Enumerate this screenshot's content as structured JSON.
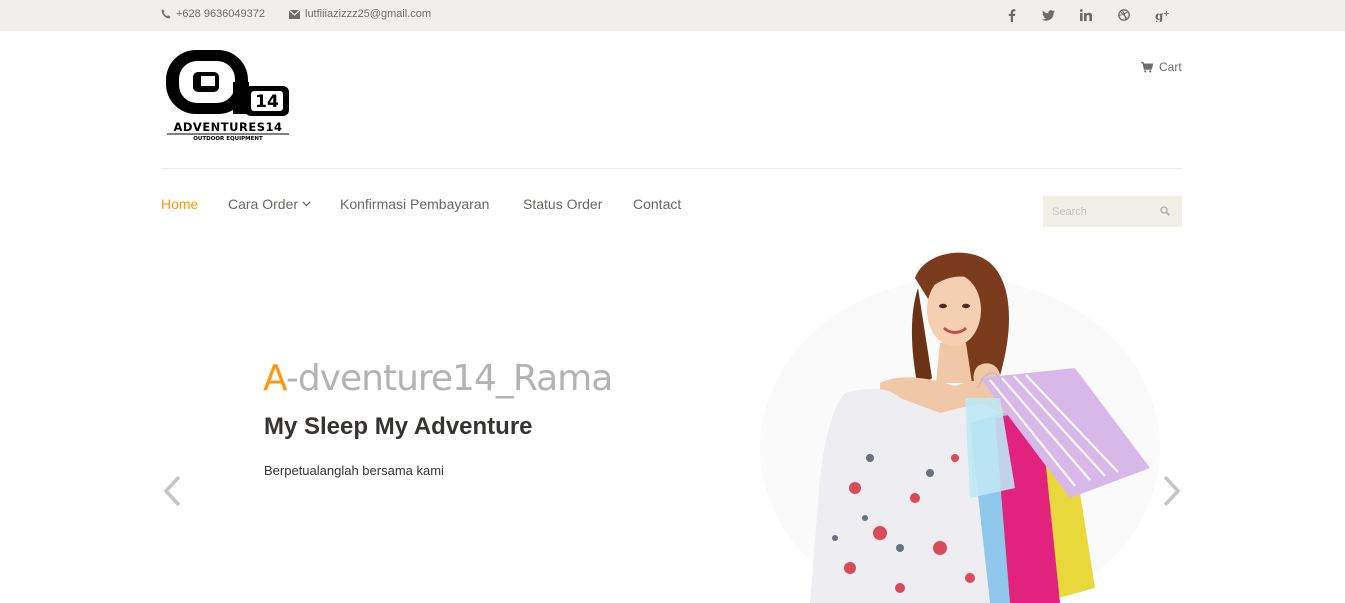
{
  "topbar": {
    "phone": "+628 9636049372",
    "email": "lutfiiiazizzz25@gmail.com",
    "phone_icon": "phone-icon",
    "email_icon": "envelope-icon",
    "social": [
      {
        "name": "facebook-icon",
        "glyph": "f"
      },
      {
        "name": "twitter-icon",
        "glyph": "t"
      },
      {
        "name": "linkedin-icon",
        "glyph": "in"
      },
      {
        "name": "dribbble-icon",
        "glyph": "◎"
      },
      {
        "name": "google-plus-icon",
        "glyph": "g+"
      }
    ]
  },
  "header": {
    "logo": {
      "mark": "14",
      "name": "ADVENTURES14",
      "tagline": "OUTDOOR EQUIPMENT"
    },
    "cart_label": "Cart",
    "cart_icon": "shopping-cart-icon"
  },
  "nav": {
    "items": [
      {
        "label": "Home",
        "active": true
      },
      {
        "label": "Cara Order",
        "has_dropdown": true
      },
      {
        "label": "Konfirmasi Pembayaran"
      },
      {
        "label": "Status Order"
      },
      {
        "label": "Contact"
      }
    ],
    "search_placeholder": "Search",
    "search_icon": "search-icon"
  },
  "slider": {
    "title_first": "A",
    "title_rest": "-dventure14_Rama",
    "subtitle": "My Sleep My Adventure",
    "text": "Berpetualanglah bersama kami",
    "prev_icon": "chevron-left-icon",
    "next_icon": "chevron-right-icon"
  },
  "colors": {
    "accent": "#fe980f",
    "topbar_bg": "#f0efeb",
    "nav_text": "#696763",
    "search_bg": "#f0f0e9",
    "title_gray": "#b3b3b3",
    "dark_text": "#363432"
  }
}
